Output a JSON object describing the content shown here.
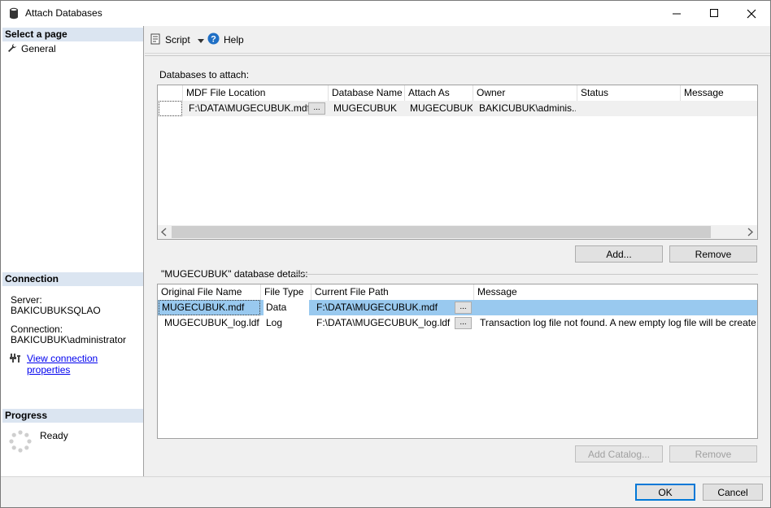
{
  "window": {
    "title": "Attach Databases"
  },
  "left": {
    "select_page_header": "Select a page",
    "pages": [
      {
        "label": "General"
      }
    ],
    "connection_header": "Connection",
    "server_label": "Server:",
    "server_value": "BAKICUBUKSQLAO",
    "connection_label": "Connection:",
    "connection_value": "BAKICUBUK\\administrator",
    "view_connection_link": "View connection properties",
    "progress_header": "Progress",
    "progress_status": "Ready"
  },
  "toolbar": {
    "script_label": "Script",
    "help_label": "Help"
  },
  "databases_to_attach": {
    "label": "Databases to attach:",
    "columns": [
      "MDF File Location",
      "Database Name",
      "Attach As",
      "Owner",
      "Status",
      "Message"
    ],
    "rows": [
      {
        "mdf": "F:\\DATA\\MUGECUBUK.mdf",
        "browse": "...",
        "db_name": "MUGECUBUK",
        "attach_as": "MUGECUBUK",
        "owner": "BAKICUBUK\\adminis...",
        "status": "",
        "message": ""
      }
    ],
    "add_button": "Add...",
    "remove_button": "Remove"
  },
  "details": {
    "label": "\"MUGECUBUK\" database details:",
    "columns": [
      "Original File Name",
      "File Type",
      "Current File Path",
      "Message"
    ],
    "rows": [
      {
        "name": "MUGECUBUK.mdf",
        "type": "Data",
        "path": "F:\\DATA\\MUGECUBUK.mdf",
        "browse": "...",
        "message": ""
      },
      {
        "name": "MUGECUBUK_log.ldf",
        "type": "Log",
        "path": "F:\\DATA\\MUGECUBUK_log.ldf",
        "browse": "...",
        "message": "Transaction log file not found. A new empty log file will be created."
      }
    ],
    "add_catalog_button": "Add Catalog...",
    "remove_button": "Remove"
  },
  "footer": {
    "ok_button": "OK",
    "cancel_button": "Cancel"
  }
}
